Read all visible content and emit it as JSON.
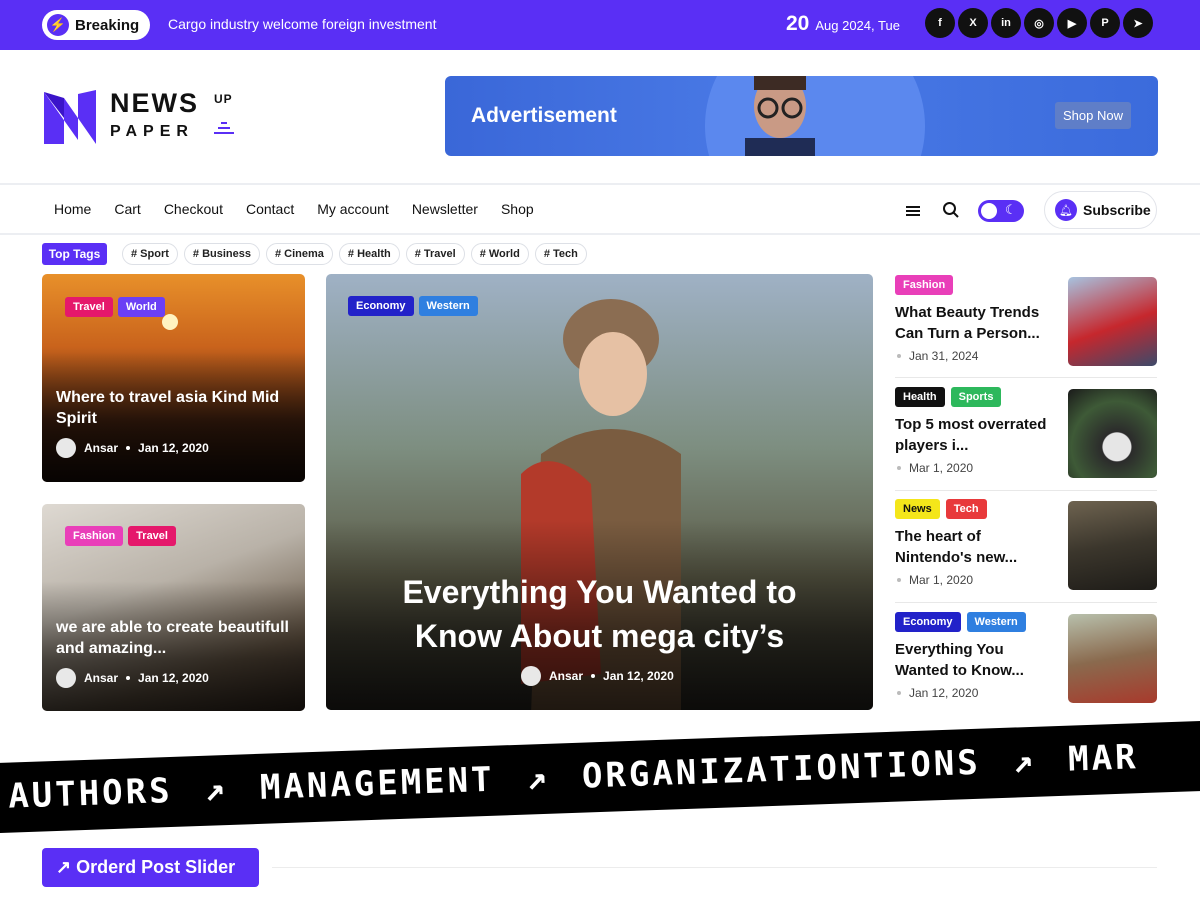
{
  "topbar": {
    "breaking_label": "Breaking",
    "ticker_text": "Cargo industry welcome foreign investment",
    "date_day": "20",
    "date_rest": "Aug 2024, Tue",
    "socials": [
      {
        "icon": "facebook-icon",
        "glyph": "f"
      },
      {
        "icon": "x-icon",
        "glyph": "X"
      },
      {
        "icon": "linkedin-icon",
        "glyph": "in"
      },
      {
        "icon": "instagram-icon",
        "glyph": "◎"
      },
      {
        "icon": "youtube-icon",
        "glyph": "▶"
      },
      {
        "icon": "pinterest-icon",
        "glyph": "P"
      },
      {
        "icon": "telegram-icon",
        "glyph": "➤"
      }
    ]
  },
  "logo": {
    "news": "NEWS",
    "up": "UP",
    "paper": "PAPER"
  },
  "ad": {
    "title": "Advertisement",
    "button": "Shop Now"
  },
  "nav": {
    "items": [
      "Home",
      "Cart",
      "Checkout",
      "Contact",
      "My account",
      "Newsletter",
      "Shop"
    ],
    "subscribe": "Subscribe"
  },
  "tags": {
    "label": "Top Tags",
    "items": [
      "# Sport",
      "# Business",
      "# Cinema",
      "# Health",
      "# Travel",
      "# World",
      "# Tech"
    ]
  },
  "cards": [
    {
      "badges": [
        "Travel",
        "World"
      ],
      "title": "Where to travel asia Kind Mid Spirit",
      "author": "Ansar",
      "date": "Jan 12, 2020"
    },
    {
      "badges": [
        "Fashion",
        "Travel"
      ],
      "title": "we are able to create beautifull and amazing...",
      "author": "Ansar",
      "date": "Jan 12, 2020"
    },
    {
      "badges": [
        "Economy",
        "Western"
      ],
      "title": "Everything You Wanted to Know About mega city’s",
      "author": "Ansar",
      "date": "Jan 12, 2020"
    }
  ],
  "side_list": [
    {
      "badges": [
        "Fashion"
      ],
      "title": "What Beauty Trends Can Turn a Person...",
      "date": "Jan 31, 2024"
    },
    {
      "badges": [
        "Health",
        "Sports"
      ],
      "title": "Top 5 most overrated players i...",
      "date": "Mar 1, 2020"
    },
    {
      "badges": [
        "News",
        "Tech"
      ],
      "title": "The heart of Nintendo's new...",
      "date": "Mar 1, 2020"
    },
    {
      "badges": [
        "Economy",
        "Western"
      ],
      "title": "Everything You Wanted to Know...",
      "date": "Jan 12, 2020"
    }
  ],
  "band": {
    "words": [
      "AUTHORS",
      "MANAGEMENT",
      "ORGANIZATIONTIONS",
      "MAR"
    ],
    "arrow": "↗"
  },
  "section": {
    "button": "↗ Orderd Post Slider"
  },
  "colors": {
    "primary": "#5a2ff5",
    "travel": "#e5186b",
    "world": "#6b3ff5",
    "fashion": "#e93fb9",
    "economy": "#2222c9",
    "western": "#2f7fe0",
    "health": "#111111",
    "sports": "#2db85c",
    "news": "#f4e61a",
    "tech": "#e8393b"
  }
}
